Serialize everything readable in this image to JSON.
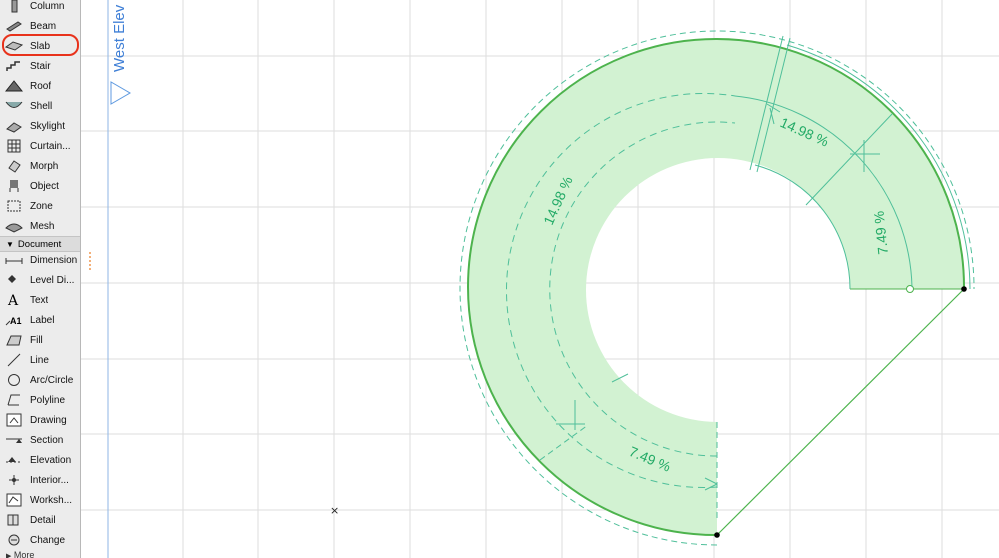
{
  "toolbox": {
    "design_tools": [
      {
        "label": "Column",
        "icon": "column-icon"
      },
      {
        "label": "Beam",
        "icon": "beam-icon"
      },
      {
        "label": "Slab",
        "icon": "slab-icon",
        "selected": true
      },
      {
        "label": "Stair",
        "icon": "stair-icon"
      },
      {
        "label": "Roof",
        "icon": "roof-icon"
      },
      {
        "label": "Shell",
        "icon": "shell-icon"
      },
      {
        "label": "Skylight",
        "icon": "skylight-icon"
      },
      {
        "label": "Curtain...",
        "icon": "curtain-wall-icon"
      },
      {
        "label": "Morph",
        "icon": "morph-icon"
      },
      {
        "label": "Object",
        "icon": "object-icon"
      },
      {
        "label": "Zone",
        "icon": "zone-icon"
      },
      {
        "label": "Mesh",
        "icon": "mesh-icon"
      }
    ],
    "document_section": "Document",
    "document_tools": [
      {
        "label": "Dimension",
        "icon": "dimension-icon"
      },
      {
        "label": "Level Di...",
        "icon": "level-dimension-icon"
      },
      {
        "label": "Text",
        "icon": "text-icon"
      },
      {
        "label": "Label",
        "icon": "label-icon"
      },
      {
        "label": "Fill",
        "icon": "fill-icon"
      },
      {
        "label": "Line",
        "icon": "line-icon"
      },
      {
        "label": "Arc/Circle",
        "icon": "arc-circle-icon"
      },
      {
        "label": "Polyline",
        "icon": "polyline-icon"
      },
      {
        "label": "Drawing",
        "icon": "drawing-icon"
      },
      {
        "label": "Section",
        "icon": "section-icon"
      },
      {
        "label": "Elevation",
        "icon": "elevation-icon"
      },
      {
        "label": "Interior...",
        "icon": "interior-elevation-icon"
      },
      {
        "label": "Worksh...",
        "icon": "worksheet-icon"
      },
      {
        "label": "Detail",
        "icon": "detail-icon"
      },
      {
        "label": "Change",
        "icon": "change-icon"
      }
    ],
    "more_label": "More"
  },
  "canvas": {
    "elevation_marker": "West Elev",
    "dimensions": {
      "outer_arc_top": "14.98 %",
      "outer_arc_left": "14.98 %",
      "right_edge": "7.49 %",
      "bottom_inner": "7.49 %"
    },
    "colors": {
      "slab_fill": "#cff0cf",
      "slab_edge": "#55bb55",
      "dimension_line": "#4fbf9a",
      "dimension_text": "#22aa66",
      "grid": "#dddddd",
      "marker": "#4a8ad4",
      "selection": "#e8321b"
    }
  }
}
